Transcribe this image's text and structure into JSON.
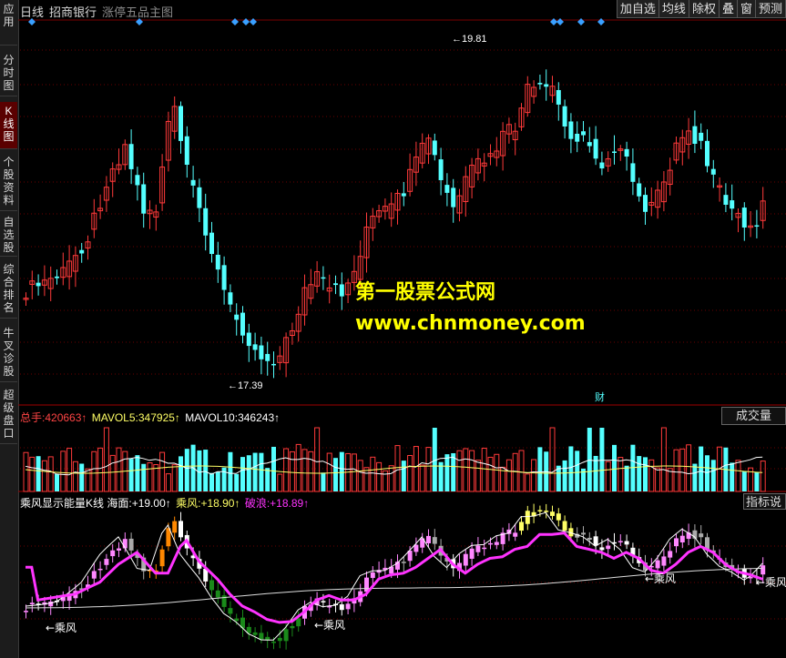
{
  "sidebar": {
    "tabs": [
      {
        "label": "应用"
      },
      {
        "label": "分时图"
      },
      {
        "label": "K线图"
      },
      {
        "label": "个股资料"
      },
      {
        "label": "自选股"
      },
      {
        "label": "综合排名"
      },
      {
        "label": "牛叉诊股"
      },
      {
        "label": "超级盘口"
      }
    ]
  },
  "header": {
    "period": "日线",
    "stock_name": "招商银行",
    "template": "涨停五品主图"
  },
  "toolbar": {
    "buttons": [
      "加自选",
      "均线",
      "除权",
      "叠",
      "窗",
      "预测"
    ]
  },
  "price_chart": {
    "high_label": "19.81",
    "low_label": "17.39",
    "event_marker": "财",
    "ylim": [
      17.2,
      20.2
    ]
  },
  "volume_panel": {
    "total_label": "总手:",
    "total_value": "420663↑",
    "mavol5_label": "MAVOL5:",
    "mavol5_value": "347925↑",
    "mavol10_label": "MAVOL10:",
    "mavol10_value": "346243↑",
    "tag": "成交量"
  },
  "indicator_panel": {
    "name": "乘风显示能量K线",
    "haimian_label": "海面:",
    "haimian_value": "+19.00↑",
    "chengfeng_label": "乘风:",
    "chengfeng_value": "+18.90↑",
    "polang_label": "破浪:",
    "polang_value": "+18.89↑",
    "tag": "指标说",
    "annotations": [
      "←乘风",
      "←乘风",
      "←乘风",
      "←乘风"
    ]
  },
  "watermark": {
    "line1": "第一股票公式网",
    "line2": "www.chnmoney.com"
  },
  "colors": {
    "up": "#ff3a3a",
    "down": "#54ffff",
    "grid": "#7a0000",
    "ma_white": "#ffffff",
    "ma_magenta": "#ff33ff",
    "marker": "#3aa0ff",
    "watermark": "#ffff00"
  },
  "chart_data": {
    "type": "candlestick",
    "series": [
      {
        "close": [
          17.86
        ]
      },
      {
        "close": [
          17.9
        ]
      }
    ]
  }
}
